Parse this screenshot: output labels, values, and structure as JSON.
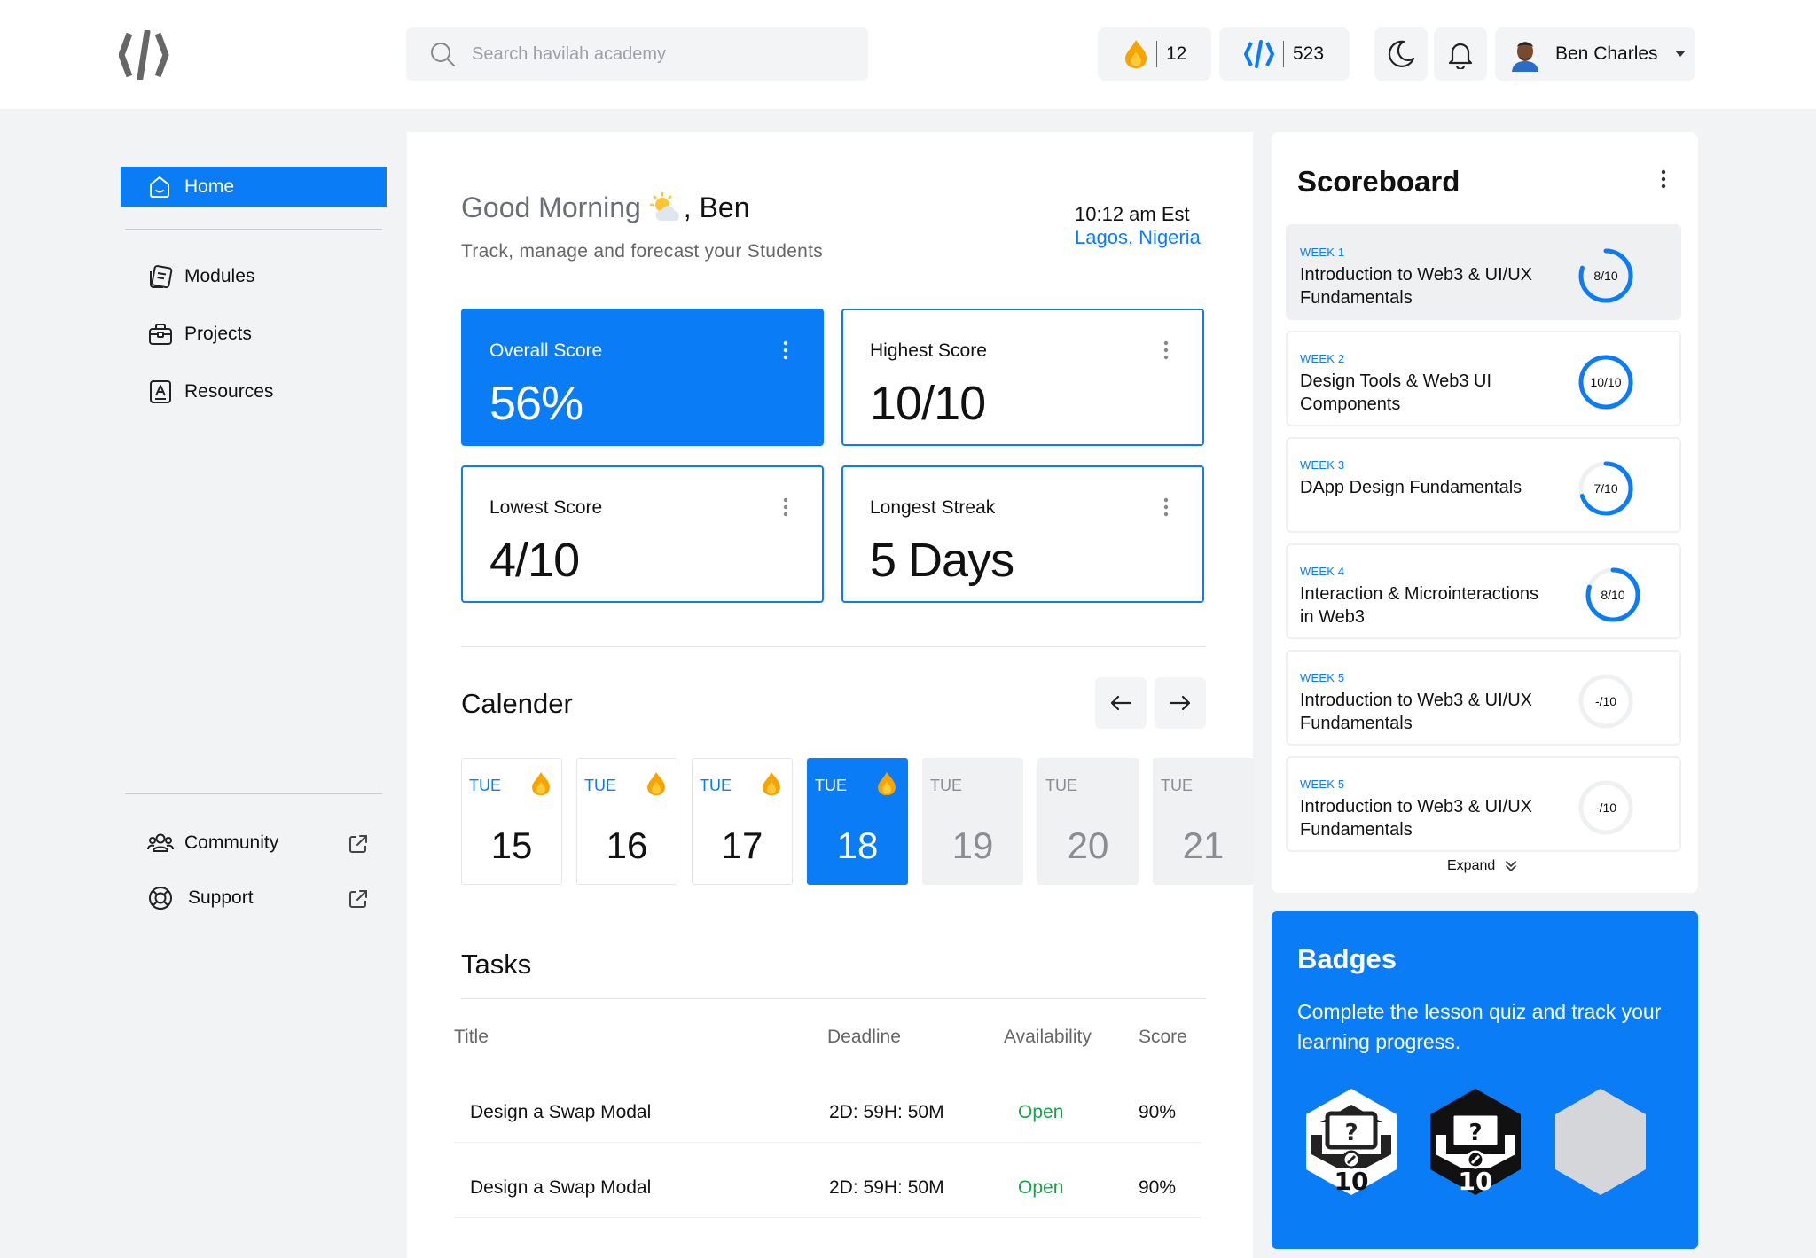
{
  "header": {
    "search_placeholder": "Search havilah academy",
    "streak_count": "12",
    "points_count": "523",
    "user_name": "Ben Charles"
  },
  "sidebar": {
    "home": "Home",
    "items": [
      "Modules",
      "Projects",
      "Resources"
    ],
    "bottom": [
      "Community",
      "Support"
    ]
  },
  "greeting": {
    "prefix": "Good Morning",
    "name": ", Ben",
    "subtitle": "Track, manage and forecast your Students",
    "time": "10:12 am Est",
    "location": "Lagos, Nigeria"
  },
  "stats": [
    {
      "label": "Overall Score",
      "value": "56%"
    },
    {
      "label": "Highest Score",
      "value": "10/10"
    },
    {
      "label": "Lowest Score",
      "value": "4/10"
    },
    {
      "label": "Longest Streak",
      "value": "5 Days"
    }
  ],
  "calendar": {
    "title": "Calender",
    "days": [
      {
        "name": "TUE",
        "date": "15",
        "state": "done"
      },
      {
        "name": "TUE",
        "date": "16",
        "state": "done"
      },
      {
        "name": "TUE",
        "date": "17",
        "state": "done"
      },
      {
        "name": "TUE",
        "date": "18",
        "state": "active"
      },
      {
        "name": "TUE",
        "date": "19",
        "state": "future"
      },
      {
        "name": "TUE",
        "date": "20",
        "state": "future"
      },
      {
        "name": "TUE",
        "date": "21",
        "state": "future"
      }
    ]
  },
  "tasks": {
    "title": "Tasks",
    "columns": [
      "Title",
      "Deadline",
      "Availability",
      "Score"
    ],
    "rows": [
      {
        "title": "Design a Swap Modal",
        "deadline": "2D: 59H: 50M",
        "availability": "Open",
        "score": "90%"
      },
      {
        "title": "Design a Swap Modal",
        "deadline": "2D: 59H: 50M",
        "availability": "Open",
        "score": "90%"
      }
    ]
  },
  "scoreboard": {
    "title": "Scoreboard",
    "expand_label": "Expand",
    "weeks": [
      {
        "week": "WEEK 1",
        "title": "Introduction to Web3 & UI/UX Fundamentals",
        "score": "8/10",
        "fraction": 0.8
      },
      {
        "week": "WEEK 2",
        "title": "Design Tools & Web3 UI Components",
        "score": "10/10",
        "fraction": 1.0
      },
      {
        "week": "WEEK 3",
        "title": "DApp Design Fundamentals",
        "score": "7/10",
        "fraction": 0.7
      },
      {
        "week": "WEEK 4",
        "title": "Interaction & Microinteractions in Web3",
        "score": "8/10",
        "fraction": 0.8
      },
      {
        "week": "WEEK 5",
        "title": "Introduction to Web3 & UI/UX Fundamentals",
        "score": "-/10",
        "fraction": 0
      },
      {
        "week": "WEEK 5",
        "title": "Introduction to Web3 & UI/UX Fundamentals",
        "score": "-/10",
        "fraction": 0
      }
    ]
  },
  "badges": {
    "title": "Badges",
    "description": "Complete the lesson quiz and track your learning progress.",
    "items": [
      {
        "label": "10",
        "style": "light"
      },
      {
        "label": "10",
        "style": "dark"
      },
      {
        "label": "",
        "style": "locked"
      }
    ]
  },
  "colors": {
    "accent": "#0a7df6",
    "open": "#17a34a",
    "flame": "#f7a400"
  }
}
